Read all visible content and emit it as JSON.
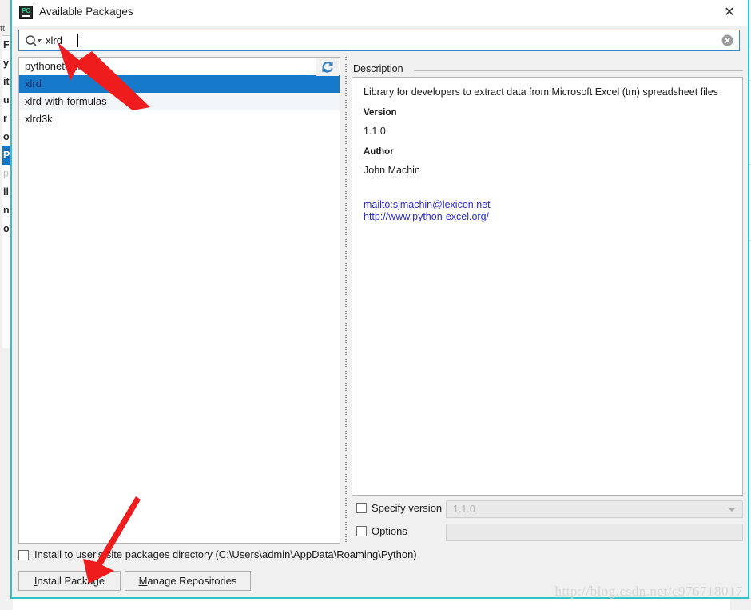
{
  "window": {
    "title": "Available Packages",
    "app_icon": "pycharm-icon",
    "close_label": "✕"
  },
  "search": {
    "value": "xlrd",
    "placeholder": "",
    "icon": "search-icon",
    "clear_icon": "clear-circle-icon"
  },
  "package_list": {
    "refresh_icon": "refresh-icon",
    "items": [
      {
        "name": "pythonetl-xlrd",
        "selected": false
      },
      {
        "name": "xlrd",
        "selected": true
      },
      {
        "name": "xlrd-with-formulas",
        "selected": false
      },
      {
        "name": "xlrd3k",
        "selected": false
      }
    ]
  },
  "description": {
    "legend": "Description",
    "summary": "Library for developers to extract data from Microsoft Excel (tm) spreadsheet files",
    "version_label": "Version",
    "version_value": "1.1.0",
    "author_label": "Author",
    "author_value": "John Machin",
    "links": [
      "mailto:sjmachin@lexicon.net",
      "http://www.python-excel.org/"
    ]
  },
  "options": {
    "specify_version_label": "Specify version",
    "specify_version_checked": false,
    "specify_version_value": "1.1.0",
    "options_label": "Options",
    "options_checked": false,
    "options_value": ""
  },
  "footer": {
    "install_user_label": "Install to user's site packages directory (C:\\Users\\admin\\AppData\\Roaming\\Python)",
    "install_user_checked": false,
    "install_button_mnemonic": "I",
    "install_button_rest": "nstall Package",
    "manage_button_mnemonic": "M",
    "manage_button_rest": "anage Repositories"
  },
  "watermark": "http://blog.csdn.net/c976718017",
  "background_window": {
    "top_fragment": "tt",
    "left_fragments": [
      "F",
      "y",
      "it",
      "u",
      "r",
      "o.",
      "P",
      "p",
      "il",
      "n",
      "o"
    ]
  },
  "colors": {
    "window_border": "#31c2c8",
    "selection": "#1779c9",
    "link": "#2a2ad0",
    "annotation_arrow": "#ee1c1c",
    "search_border": "#3c86c8"
  }
}
